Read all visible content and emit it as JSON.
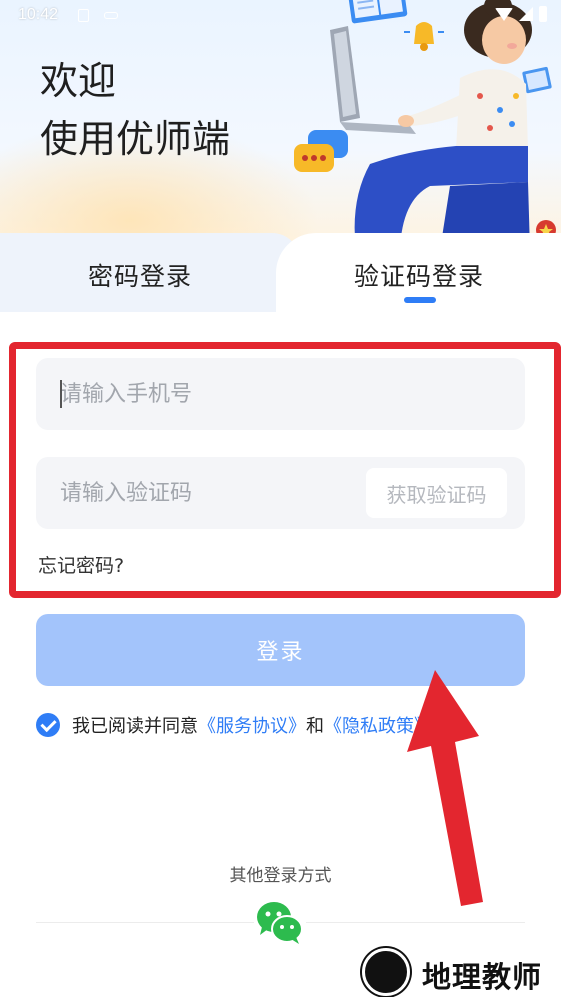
{
  "status_bar": {
    "time": "10:42"
  },
  "header": {
    "welcome_line1": "欢迎",
    "welcome_line2": "使用优师端"
  },
  "tabs": [
    {
      "label": "密码登录",
      "active": false
    },
    {
      "label": "验证码登录",
      "active": true
    }
  ],
  "form": {
    "phone_placeholder": "请输入手机号",
    "code_placeholder": "请输入验证码",
    "get_code_label": "获取验证码",
    "forgot_label": "忘记密码?",
    "login_label": "登录"
  },
  "agreement": {
    "checked": true,
    "prefix": "我已阅读并同意",
    "service_link": "《服务协议》",
    "and": "和",
    "privacy_link": "《隐私政策》"
  },
  "other_login": {
    "title": "其他登录方式",
    "method": "wechat-icon"
  },
  "watermark": {
    "text": "地理教师"
  },
  "colors": {
    "accent": "#2f7df6",
    "login_disabled": "#a3c4fb",
    "annotation_red": "#e3262f"
  }
}
